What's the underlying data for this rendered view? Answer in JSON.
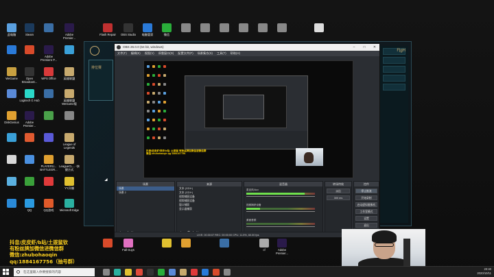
{
  "desktop": {
    "icons_top": [
      {
        "label": "此电脑",
        "icon": "computer-icon",
        "color": "#5aa0e0"
      },
      {
        "label": "Steam",
        "icon": "steam-icon",
        "color": "#1b3a5c"
      },
      {
        "label": "",
        "icon": "app-icon",
        "color": "#3a6ea5"
      },
      {
        "label": "Adobe Premier...",
        "icon": "premiere-icon",
        "color": "#2a1a4a"
      },
      {
        "label": "Flash Repair",
        "icon": "flash-repair-icon",
        "color": "#c03030"
      },
      {
        "label": "OBS Studio",
        "icon": "obs-icon",
        "color": "#333333"
      },
      {
        "label": "电脑管家",
        "icon": "tencent-pc-manager-icon",
        "color": "#2a7ad8"
      },
      {
        "label": "微信",
        "icon": "wechat-icon",
        "color": "#2aae3a"
      },
      {
        "label": "",
        "icon": "file-icon",
        "color": "#888888"
      },
      {
        "label": "",
        "icon": "file-icon",
        "color": "#888888"
      },
      {
        "label": "",
        "icon": "file-icon",
        "color": "#888888"
      },
      {
        "label": "",
        "icon": "file-icon",
        "color": "#888888"
      },
      {
        "label": "",
        "icon": "file-icon",
        "color": "#888888"
      },
      {
        "label": "",
        "icon": "file-icon",
        "color": "#888888"
      },
      {
        "label": "",
        "icon": "txt-file-icon",
        "color": "#dddddd"
      }
    ],
    "icons_left": [
      {
        "label": "",
        "icon": "app-icon",
        "color": "#2a7ad8"
      },
      {
        "label": "",
        "icon": "app-icon",
        "color": "#d84a2a"
      },
      {
        "label": "Adobe Premiere P...",
        "icon": "premiere-icon",
        "color": "#2a1a4a"
      },
      {
        "label": "",
        "icon": "app-icon",
        "color": "#3aa0d8"
      },
      {
        "label": "WeGame",
        "icon": "wegame-icon",
        "color": "#c8a040"
      },
      {
        "label": "Open Broadcast...",
        "icon": "obs-icon",
        "color": "#333333"
      },
      {
        "label": "WPS Office",
        "icon": "wps-icon",
        "color": "#d83a3a"
      },
      {
        "label": "英雄联盟",
        "icon": "lol-icon",
        "color": "#c8aa6e"
      },
      {
        "label": "",
        "icon": "app-icon",
        "color": "#5a8ad8"
      },
      {
        "label": "Logitech G Hub",
        "icon": "logitech-icon",
        "color": "#2ad8c8"
      },
      {
        "label": "",
        "icon": "app-icon",
        "color": "#3a6ea5"
      },
      {
        "label": "英雄联盟 WeGame版",
        "icon": "lol-icon",
        "color": "#c8aa6e"
      },
      {
        "label": "DiskGenius",
        "icon": "disk-icon",
        "color": "#e0a030"
      },
      {
        "label": "Adobe Premier...",
        "icon": "premiere-icon",
        "color": "#2a1a4a"
      },
      {
        "label": "",
        "icon": "app-icon",
        "color": "#4aa04a"
      },
      {
        "label": "",
        "icon": "app-icon",
        "color": "#888888"
      },
      {
        "label": "",
        "icon": "app-icon",
        "color": "#3aa0d8"
      },
      {
        "label": "",
        "icon": "app-icon",
        "color": "#e05a30"
      },
      {
        "label": "",
        "icon": "app-icon",
        "color": "#5a5ad8"
      },
      {
        "label": "League of Legends",
        "icon": "lol-icon",
        "color": "#c8aa6e"
      },
      {
        "label": "",
        "icon": "app-icon",
        "color": "#d8d8d8"
      },
      {
        "label": "",
        "icon": "app-icon",
        "color": "#4a90e0"
      },
      {
        "label": "PLAYERU... BATTLEGR...",
        "icon": "pubg-icon",
        "color": "#e0a030"
      },
      {
        "label": "LeagueCL... -快捷方式",
        "icon": "lol-icon",
        "color": "#c8aa6e"
      },
      {
        "label": "",
        "icon": "app-icon",
        "color": "#5ab0e0"
      },
      {
        "label": "",
        "icon": "app-icon",
        "color": "#3aa03a"
      },
      {
        "label": "",
        "icon": "app-icon",
        "color": "#e03a3a"
      },
      {
        "label": "YY开播",
        "icon": "yy-icon",
        "color": "#e0c030"
      },
      {
        "label": "",
        "icon": "app-icon",
        "color": "#2a8ad8"
      },
      {
        "label": "QQ",
        "icon": "qq-icon",
        "color": "#2a9ae0"
      },
      {
        "label": "QQ游戏",
        "icon": "qq-game-icon",
        "color": "#e05a2a"
      },
      {
        "label": "Microsoft Edge",
        "icon": "edge-icon",
        "color": "#2ab0a0"
      }
    ],
    "icons_bottom": [
      {
        "label": "",
        "icon": "app-icon",
        "color": "#d84a2a"
      },
      {
        "label": "Fall Guys",
        "icon": "fall-guys-icon",
        "color": "#e070c0"
      },
      {
        "label": "",
        "icon": "app-icon",
        "color": "#e0c030"
      },
      {
        "label": "",
        "icon": "app-icon",
        "color": "#e0a030"
      },
      {
        "label": "",
        "icon": "app-icon",
        "color": "#3a6ea5"
      },
      {
        "label": "cf",
        "icon": "cf-icon",
        "color": "#aaaaaa"
      },
      {
        "label": "Adobe Premier...",
        "icon": "premiere-icon",
        "color": "#2a1a4a"
      }
    ]
  },
  "obs": {
    "window_title": "OBS 26.0.0 (64 bit, windows)",
    "menu": [
      "文件(F)",
      "编辑(E)",
      "视图(V)",
      "停靠窗口(D)",
      "配置文件(P)",
      "场景集合(S)",
      "工具(T)",
      "帮助(H)"
    ],
    "panels": {
      "scenes": {
        "title": "场景",
        "items": [
          "场景",
          "场景 2"
        ],
        "selected": 0
      },
      "sources": {
        "title": "来源",
        "items": [
          "文本 (GDI+)",
          "文本 (GDI+)",
          "视频捕获设备",
          "视频捕获设备",
          "窗口捕获",
          "显示器捕获"
        ]
      },
      "mixer": {
        "title": "混音器",
        "tracks": [
          {
            "name": "麦克风/Aux",
            "level": 0.85
          },
          {
            "name": "视频捕获设备",
            "level": 0.2
          },
          {
            "name": "桌面音频",
            "level": 0.0
          }
        ]
      },
      "transitions": {
        "title": "转场特效",
        "type": "淡出",
        "duration": "300 ms"
      },
      "controls": {
        "title": "控件",
        "buttons": [
          "停止推流",
          "开始录制",
          "启动虚拟摄像机",
          "工作室模式",
          "设置",
          "退出"
        ]
      }
    },
    "status": "LIVE: 00:30:07   REC: 00:00:00   CPU: 11.5%, 60.00 fps"
  },
  "preview": {
    "overlay_text": "抖音/皮皮虾/快手/b站: 土拨鼠 有粉丝牌加微信进微信群 微信:zhubohaoqin qq:1884167756"
  },
  "streamer_text": {
    "line1": "抖音/皮皮虾/b站/土拨鼠钦",
    "line2": "有粉丝牌加微信进微信群",
    "line3": "微信:zhubohaoqin",
    "line4": "qq:1884167756（抽号群）"
  },
  "game_client": {
    "sidebar_label": "排位赛",
    "player_tag": "FḻgH"
  },
  "taskbar": {
    "search_placeholder": "在这里输入你要搜索的内容",
    "time": "20:40",
    "date": "2020/10/11",
    "apps": [
      {
        "icon": "task-view-icon",
        "color": "#888888"
      },
      {
        "icon": "edge-icon",
        "color": "#2ab0a0"
      },
      {
        "icon": "explorer-icon",
        "color": "#e0c030"
      },
      {
        "icon": "chrome-icon",
        "color": "#e04a3a"
      },
      {
        "icon": "obs-icon",
        "color": "#333333"
      },
      {
        "icon": "wechat-icon",
        "color": "#2aae3a"
      },
      {
        "icon": "app-icon",
        "color": "#5a8ad8"
      },
      {
        "icon": "lol-icon",
        "color": "#c8aa6e"
      },
      {
        "icon": "app-icon",
        "color": "#e03a3a"
      },
      {
        "icon": "app-icon",
        "color": "#2a7ad8"
      },
      {
        "icon": "app-icon",
        "color": "#d84a2a"
      },
      {
        "icon": "app-icon",
        "color": "#888888"
      }
    ]
  }
}
